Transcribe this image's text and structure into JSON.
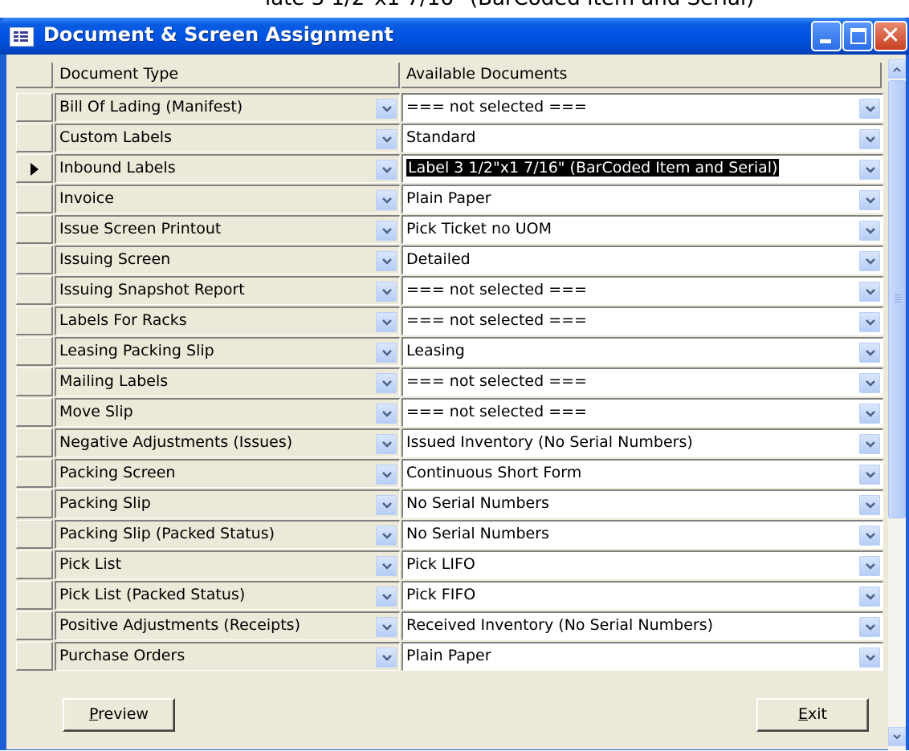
{
  "background_caption": "late 3 1/2\"x1 7/16\" (BarCoded Item and Serial)",
  "window": {
    "title": "Document & Screen  Assignment",
    "icon": "form-icon",
    "controls": [
      "minimize-icon",
      "maximize-icon",
      "close-icon"
    ]
  },
  "columns": {
    "document_type": "Document Type",
    "available_documents": "Available Documents"
  },
  "rows": [
    {
      "document_type": "Bill Of Lading (Manifest)",
      "available_document": "=== not selected ==="
    },
    {
      "document_type": "Custom Labels",
      "available_document": "Standard"
    },
    {
      "document_type": "Inbound Labels",
      "available_document": "Label 3 1/2\"x1 7/16\" (BarCoded Item and Serial)",
      "current": true
    },
    {
      "document_type": "Invoice",
      "available_document": "Plain Paper"
    },
    {
      "document_type": "Issue Screen Printout",
      "available_document": "Pick Ticket no UOM"
    },
    {
      "document_type": "Issuing Screen",
      "available_document": "Detailed"
    },
    {
      "document_type": "Issuing Snapshot Report",
      "available_document": "=== not selected ==="
    },
    {
      "document_type": "Labels For Racks",
      "available_document": "=== not selected ==="
    },
    {
      "document_type": "Leasing Packing Slip",
      "available_document": "Leasing"
    },
    {
      "document_type": "Mailing Labels",
      "available_document": "=== not selected ==="
    },
    {
      "document_type": "Move Slip",
      "available_document": "=== not selected ==="
    },
    {
      "document_type": "Negative Adjustments (Issues)",
      "available_document": "Issued Inventory (No Serial Numbers)"
    },
    {
      "document_type": "Packing Screen",
      "available_document": "Continuous Short Form"
    },
    {
      "document_type": "Packing Slip",
      "available_document": "No Serial Numbers"
    },
    {
      "document_type": "Packing Slip (Packed Status)",
      "available_document": "No Serial Numbers"
    },
    {
      "document_type": "Pick List",
      "available_document": "Pick LIFO"
    },
    {
      "document_type": "Pick List (Packed Status)",
      "available_document": "Pick FIFO"
    },
    {
      "document_type": "Positive Adjustments (Receipts)",
      "available_document": "Received Inventory (No Serial Numbers)"
    },
    {
      "document_type": "Purchase Orders",
      "available_document": "Plain Paper"
    }
  ],
  "buttons": {
    "preview": {
      "mnemonic": "P",
      "rest": "review"
    },
    "exit": {
      "mnemonic": "E",
      "rest": "xit"
    }
  },
  "colors": {
    "titlebar": "#0054e3",
    "client_background": "#ece9d8",
    "selection_highlight": "#000000"
  }
}
